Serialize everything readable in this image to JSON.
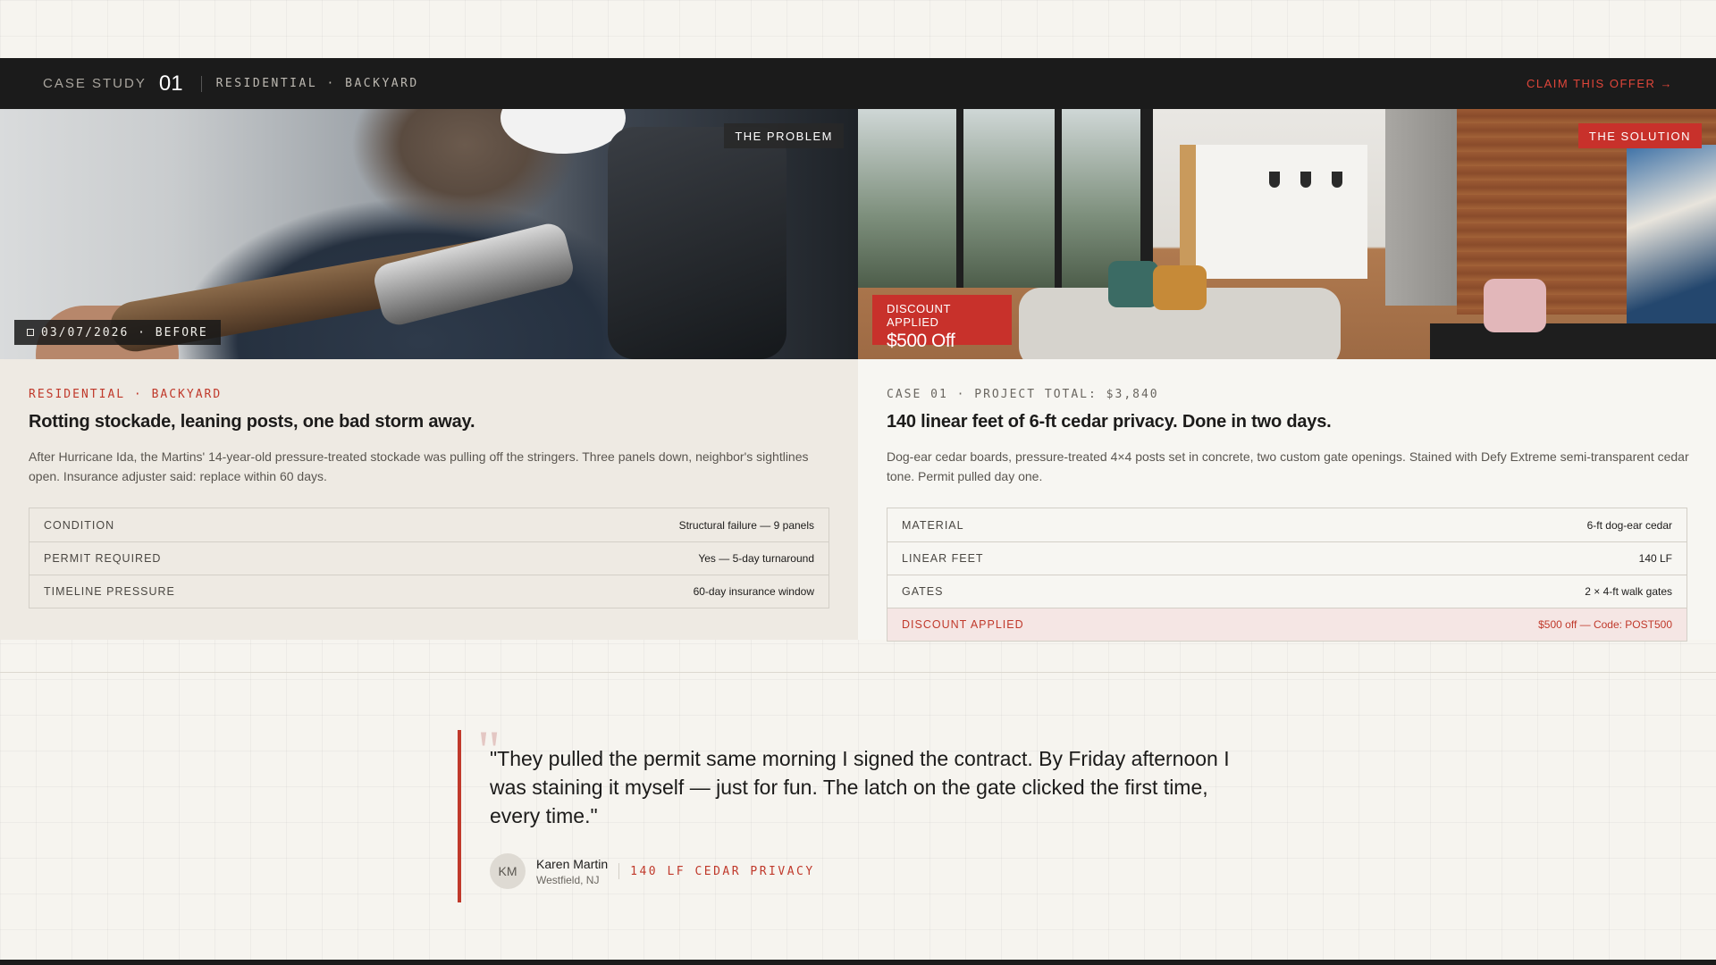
{
  "header": {
    "case_label": "CASE STUDY",
    "case_number": "01",
    "tags": "RESIDENTIAL · BACKYARD",
    "cta": "CLAIM THIS OFFER →"
  },
  "before": {
    "badge": "THE PROBLEM",
    "date_chip": "03/07/2026 · BEFORE",
    "eyebrow": "RESIDENTIAL · BACKYARD",
    "headline": "Rotting stockade, leaning posts, one bad storm away.",
    "body": "After Hurricane Ida, the Martins' 14-year-old pressure-treated stockade was pulling off the stringers. Three panels down, neighbor's sightlines open. Insurance adjuster said: replace within 60 days.",
    "specs": [
      {
        "key": "CONDITION",
        "value": "Structural failure — 9 panels"
      },
      {
        "key": "PERMIT REQUIRED",
        "value": "Yes — 5-day turnaround"
      },
      {
        "key": "TIMELINE PRESSURE",
        "value": "60-day insurance window"
      }
    ]
  },
  "after": {
    "badge": "THE SOLUTION",
    "discount_label": "DISCOUNT APPLIED",
    "discount_value": "$500 Off",
    "eyebrow": "CASE 01 · PROJECT TOTAL: $3,840",
    "headline": "140 linear feet of 6-ft cedar privacy. Done in two days.",
    "body": "Dog-ear cedar boards, pressure-treated 4×4 posts set in concrete, two custom gate openings. Stained with Defy Extreme semi-transparent cedar tone. Permit pulled day one.",
    "specs": [
      {
        "key": "MATERIAL",
        "value": "6-ft dog-ear cedar"
      },
      {
        "key": "LINEAR FEET",
        "value": "140 LF"
      },
      {
        "key": "GATES",
        "value": "2 × 4-ft walk gates"
      },
      {
        "key": "DISCOUNT APPLIED",
        "value": "$500 off — Code: POST500"
      }
    ]
  },
  "testimonial": {
    "quote_mark": "\"",
    "quote": "\"They pulled the permit same morning I signed the contract. By Friday afternoon I was staining it myself — just for fun. The latch on the gate clicked the first time, every time.\"",
    "avatar_initials": "KM",
    "name": "Karen Martin",
    "location": "Westfield, NJ",
    "tag": "140 LF CEDAR PRIVACY"
  },
  "colors": {
    "accent": "#c0392b",
    "dark_bar": "#1b1b1b",
    "background": "#f6f4ef"
  }
}
